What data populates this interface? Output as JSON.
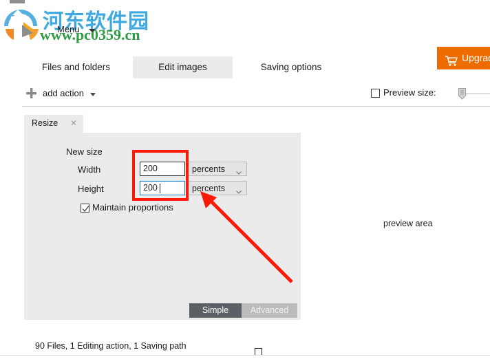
{
  "watermark": {
    "site_name_cn": "河东软件园",
    "site_url": "www.pc0359.cn",
    "logo_icon": "site-logo-icon"
  },
  "menu": {
    "label": "Menu",
    "caret_icon": "chevron-down-icon"
  },
  "tabs": [
    {
      "label": "Files and folders",
      "active": false
    },
    {
      "label": "Edit images",
      "active": true
    },
    {
      "label": "Saving options",
      "active": false
    }
  ],
  "upgrade": {
    "label": "Upgrade",
    "icon": "shopping-cart-icon",
    "color": "#ef6c00"
  },
  "toolbar": {
    "add_action_label": "add action",
    "add_action_icon": "plus-icon",
    "add_action_caret_icon": "chevron-down-icon",
    "preview_size_label": "Preview size:",
    "preview_size_checked": false,
    "slider_icon": "slider-thumb-icon"
  },
  "action_panel": {
    "tab_label": "Resize",
    "tab_close_icon": "close-icon",
    "group_label": "New size",
    "fields": [
      {
        "label": "Width",
        "value": "200",
        "placeholder": "",
        "unit": "percents",
        "focused": false
      },
      {
        "label": "Height",
        "value": "200",
        "placeholder": "",
        "unit": "percents",
        "focused": true
      }
    ],
    "unit_chevron_icon": "chevron-down-icon",
    "maintain_proportions_label": "Maintain proportions",
    "maintain_proportions_checked": true,
    "maintain_check_icon": "check-icon",
    "mode_buttons": [
      {
        "label": "Simple",
        "active": true
      },
      {
        "label": "Advanced",
        "active": false
      }
    ]
  },
  "preview": {
    "area_label": "preview area"
  },
  "status_bar": {
    "summary": "90 Files, 1 Editing action, 1 Saving path",
    "indicator_icon": "square-indicator-icon"
  },
  "annotations": {
    "highlight_color": "#fb1a08",
    "box_target": "size-input-fields",
    "arrow_target": "height-unit-dropdown"
  }
}
